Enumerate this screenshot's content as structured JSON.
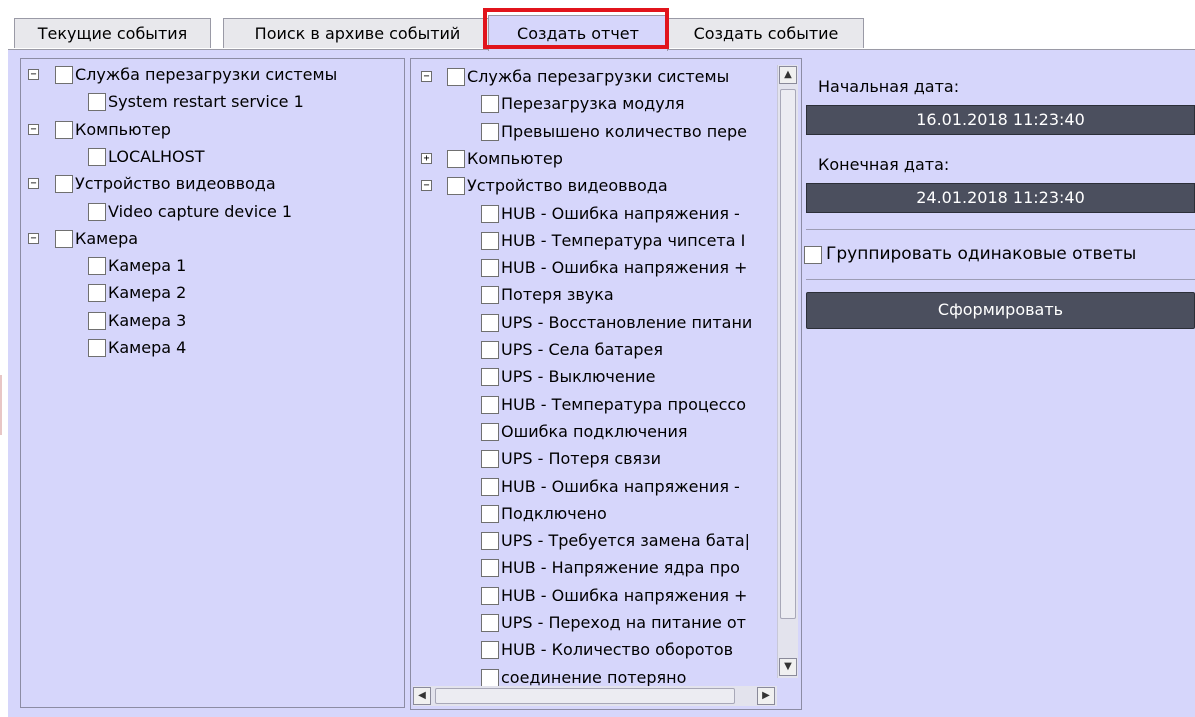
{
  "tabs": [
    {
      "label": "Текущие события",
      "active": false
    },
    {
      "label": "Поиск в архиве событий",
      "active": false
    },
    {
      "label": "Создать отчет",
      "active": true
    },
    {
      "label": "Создать событие",
      "active": false
    }
  ],
  "sources_tree": [
    {
      "label": "Служба перезагрузки системы",
      "level": 0,
      "expander": "minus"
    },
    {
      "label": "System restart service 1",
      "level": 1
    },
    {
      "label": "Компьютер",
      "level": 0,
      "expander": "minus"
    },
    {
      "label": "LOCALHOST",
      "level": 1
    },
    {
      "label": "Устройство видеоввода",
      "level": 0,
      "expander": "minus"
    },
    {
      "label": "Video capture device 1",
      "level": 1
    },
    {
      "label": "Камера",
      "level": 0,
      "expander": "minus"
    },
    {
      "label": "Камера 1",
      "level": 1
    },
    {
      "label": "Камера 2",
      "level": 1
    },
    {
      "label": "Камера 3",
      "level": 1
    },
    {
      "label": "Камера 4",
      "level": 1
    }
  ],
  "events_tree": [
    {
      "label": "Служба перезагрузки системы",
      "level": 0,
      "expander": "minus"
    },
    {
      "label": "Перезагрузка модуля",
      "level": 1
    },
    {
      "label": "Превышено количество пере",
      "level": 1
    },
    {
      "label": "Компьютер",
      "level": 0,
      "expander": "plus"
    },
    {
      "label": "Устройство видеоввода",
      "level": 0,
      "expander": "minus"
    },
    {
      "label": "HUB - Ошибка напряжения -",
      "level": 1
    },
    {
      "label": "HUB - Температура чипсета I",
      "level": 1
    },
    {
      "label": "HUB - Ошибка напряжения +",
      "level": 1
    },
    {
      "label": "Потеря звука",
      "level": 1
    },
    {
      "label": "UPS - Восстановление питани",
      "level": 1
    },
    {
      "label": "UPS - Села батарея",
      "level": 1
    },
    {
      "label": "UPS - Выключение",
      "level": 1
    },
    {
      "label": "HUB - Температура процессо",
      "level": 1
    },
    {
      "label": "Ошибка подключения",
      "level": 1
    },
    {
      "label": "UPS - Потеря связи",
      "level": 1
    },
    {
      "label": "HUB - Ошибка напряжения -",
      "level": 1
    },
    {
      "label": "Подключено",
      "level": 1
    },
    {
      "label": "UPS - Требуется замена бата|",
      "level": 1
    },
    {
      "label": "HUB - Напряжение ядра про",
      "level": 1
    },
    {
      "label": "HUB - Ошибка напряжения +",
      "level": 1
    },
    {
      "label": "UPS - Переход на питание от",
      "level": 1
    },
    {
      "label": "HUB - Количество оборотов",
      "level": 1
    },
    {
      "label": "соединение потеряно",
      "level": 1
    }
  ],
  "report": {
    "start_label": "Начальная дата:",
    "start_value": "16.01.2018 11:23:40",
    "end_label": "Конечная дата:",
    "end_value": "24.01.2018 11:23:40",
    "group_label": "Группировать одинаковые ответы",
    "group_checked": false,
    "submit_label": "Сформировать"
  },
  "icons": {
    "expand_minus": "⊟",
    "expand_plus": "⊞",
    "scroll_up": "▲",
    "scroll_down": "▼",
    "scroll_left": "◀",
    "scroll_right": "▶"
  },
  "colors": {
    "panel": "#d6d6fb",
    "dark_button": "#4b4f5e",
    "highlight": "#e1141c"
  }
}
